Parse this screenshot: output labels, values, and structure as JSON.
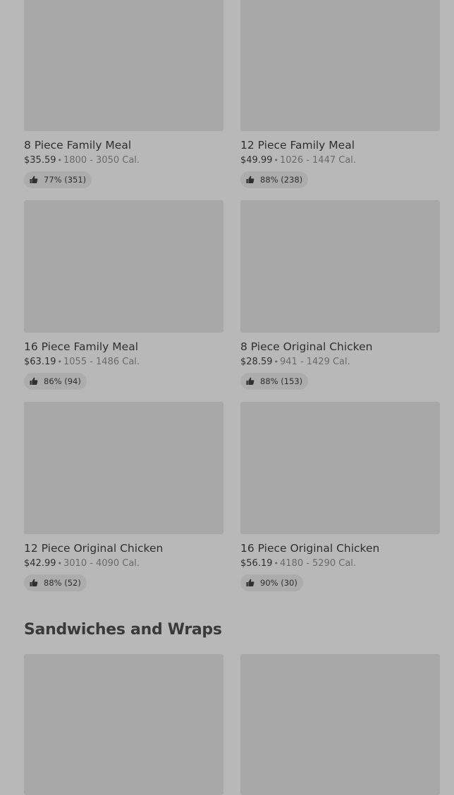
{
  "menu_items": [
    {
      "name": "8 Piece Family Meal",
      "price": "$35.59",
      "separator": "•",
      "calories": "1800 - 3050 Cal.",
      "rating": "77% (351)"
    },
    {
      "name": "12 Piece Family Meal",
      "price": "$49.99",
      "separator": "•",
      "calories": "1026 - 1447 Cal.",
      "rating": "88% (238)"
    },
    {
      "name": "16 Piece Family Meal",
      "price": "$63.19",
      "separator": "•",
      "calories": "1055 - 1486 Cal.",
      "rating": "86% (94)"
    },
    {
      "name": "8 Piece Original Chicken",
      "price": "$28.59",
      "separator": "•",
      "calories": "941 - 1429 Cal.",
      "rating": "88% (153)"
    },
    {
      "name": "12 Piece Original Chicken",
      "price": "$42.99",
      "separator": "•",
      "calories": "3010 - 4090 Cal.",
      "rating": "88% (52)"
    },
    {
      "name": "16 Piece Original Chicken",
      "price": "$56.19",
      "separator": "•",
      "calories": "4180 - 5290 Cal.",
      "rating": "90% (30)"
    }
  ],
  "section": {
    "title": "Sandwiches and Wraps"
  },
  "icons": {
    "rating": "thumbs-up-icon"
  },
  "colors": {
    "background": "#b8b8b8",
    "image_placeholder": "#a8a8a8",
    "text_primary": "#2f2f2f",
    "text_secondary": "#6a6a6a"
  }
}
